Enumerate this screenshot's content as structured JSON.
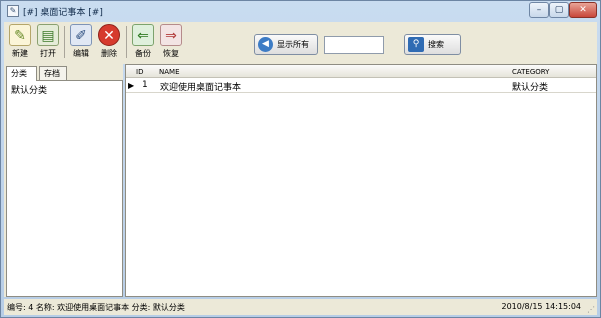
{
  "window": {
    "title": "[#] 桌面记事本 [#]"
  },
  "toolbar": {
    "new_label": "新建",
    "open_label": "打开",
    "edit_label": "编辑",
    "delete_label": "删除",
    "backup_label": "备份",
    "restore_label": "恢复",
    "show_all_label": "显示所有",
    "search_value": "",
    "search_label": "搜索"
  },
  "left_panel": {
    "tabs": [
      {
        "label": "分类"
      },
      {
        "label": "存档"
      }
    ],
    "categories": [
      {
        "label": "默认分类"
      }
    ]
  },
  "grid": {
    "columns": [
      "ID",
      "NAME",
      "CATEGORY"
    ],
    "rows": [
      {
        "id": "1",
        "name": "欢迎使用桌面记事本",
        "category": "默认分类"
      }
    ]
  },
  "status": {
    "left": "编号: 4  名称: 欢迎使用桌面记事本  分类: 默认分类",
    "datetime": "2010/8/15 14:15:04"
  }
}
